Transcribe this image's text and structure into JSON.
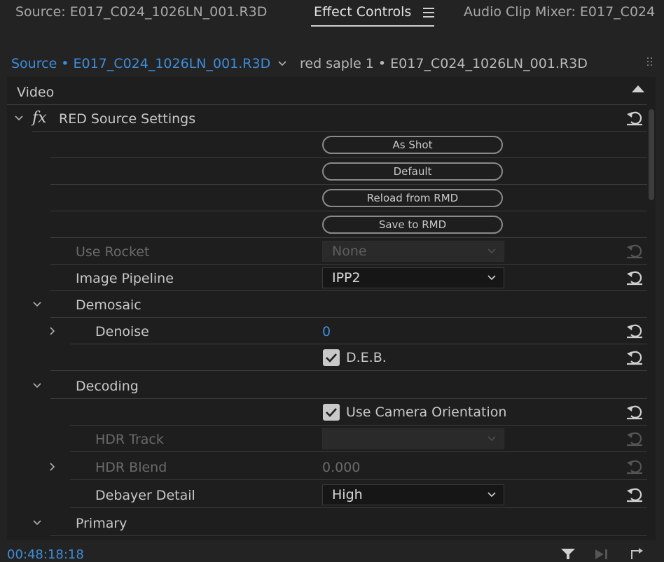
{
  "top_tabs": [
    {
      "label": "Source: E017_C024_1026LN_001.R3D"
    },
    {
      "label": "Effect Controls"
    },
    {
      "label": "Audio Clip Mixer: E017_C024"
    }
  ],
  "source_bar": {
    "active_source": "Source • E017_C024_1026LN_001.R3D",
    "sequence_clip": "red saple 1 • E017_C024_1026LN_001.R3D"
  },
  "section": {
    "video_label": "Video"
  },
  "effect": {
    "name": "RED Source Settings",
    "fx_label": "fx"
  },
  "buttons": {
    "as_shot": "As Shot",
    "default": "Default",
    "reload_rmd": "Reload from RMD",
    "save_rmd": "Save to RMD"
  },
  "props": {
    "use_rocket": {
      "label": "Use Rocket",
      "value": "None"
    },
    "image_pipeline": {
      "label": "Image Pipeline",
      "value": "IPP2"
    },
    "demosaic": {
      "label": "Demosaic"
    },
    "denoise": {
      "label": "Denoise",
      "value": "0"
    },
    "deb": {
      "label": "D.E.B.",
      "checked": true
    },
    "decoding": {
      "label": "Decoding"
    },
    "use_camera_orientation": {
      "label": "Use Camera Orientation",
      "checked": true
    },
    "hdr_track": {
      "label": "HDR Track",
      "value": ""
    },
    "hdr_blend": {
      "label": "HDR Blend",
      "value": "0.000"
    },
    "debayer_detail": {
      "label": "Debayer Detail",
      "value": "High"
    },
    "primary": {
      "label": "Primary"
    }
  },
  "footer": {
    "timecode": "00:48:18:18"
  },
  "colors": {
    "accent": "#3f8cd9",
    "panel_bg": "#1e1e1e",
    "header_bg": "#232323"
  }
}
